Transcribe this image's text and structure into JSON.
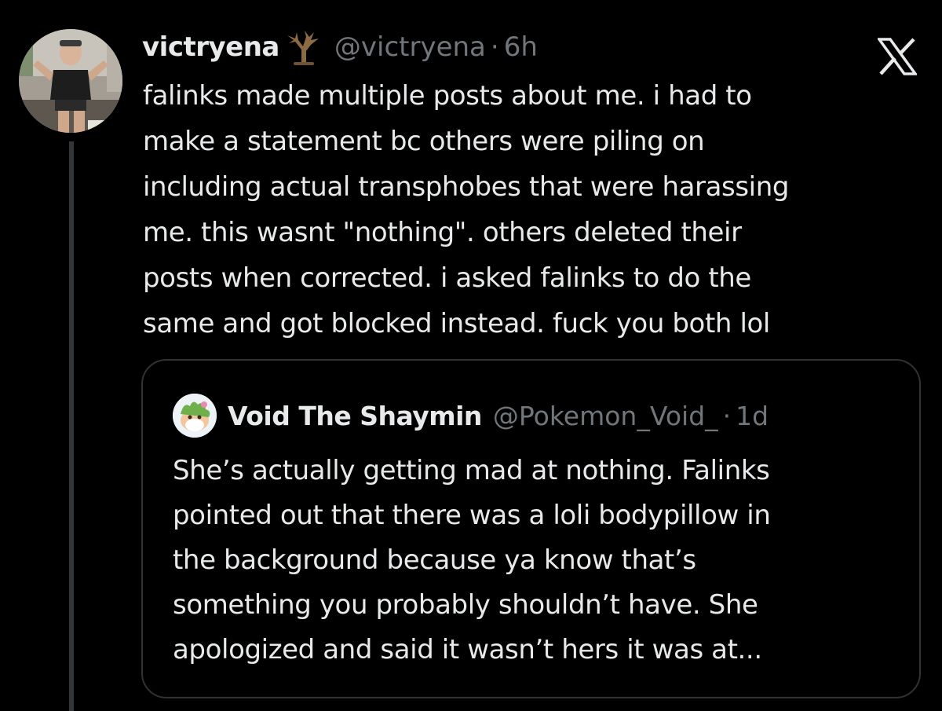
{
  "tweet": {
    "author": {
      "display_name": "victryena",
      "name_emoji": "bare-tree-emoji",
      "handle": "@victryena",
      "separator": "·",
      "time": "6h"
    },
    "text_lines": [
      "falinks made multiple posts about me. i had to",
      "make a statement bc others were piling on",
      "including actual transphobes that were harassing",
      "me. this wasnt \"nothing\". others deleted their",
      "posts when corrected. i asked falinks to do the",
      "same and got blocked instead. fuck you both lol"
    ]
  },
  "quoted_tweet": {
    "author": {
      "display_name": "Void The Shaymin",
      "handle": "@Pokemon_Void_",
      "separator": "·",
      "time": "1d"
    },
    "text_lines": [
      "She’s actually getting mad at nothing. Falinks",
      "pointed out that there was a loli bodypillow in",
      "the background because ya know that’s",
      "something you probably shouldn’t have. She",
      "apologized and said it wasn’t hers it was at..."
    ]
  },
  "icons": {
    "brand": "x-logo-icon",
    "avatar": "user-avatar",
    "quote_avatar": "shaymin-avatar"
  },
  "colors": {
    "background": "#000000",
    "primary_text": "#e7e9ea",
    "secondary_text": "#71767b",
    "border": "#2f3336",
    "thread_line": "#333639"
  }
}
